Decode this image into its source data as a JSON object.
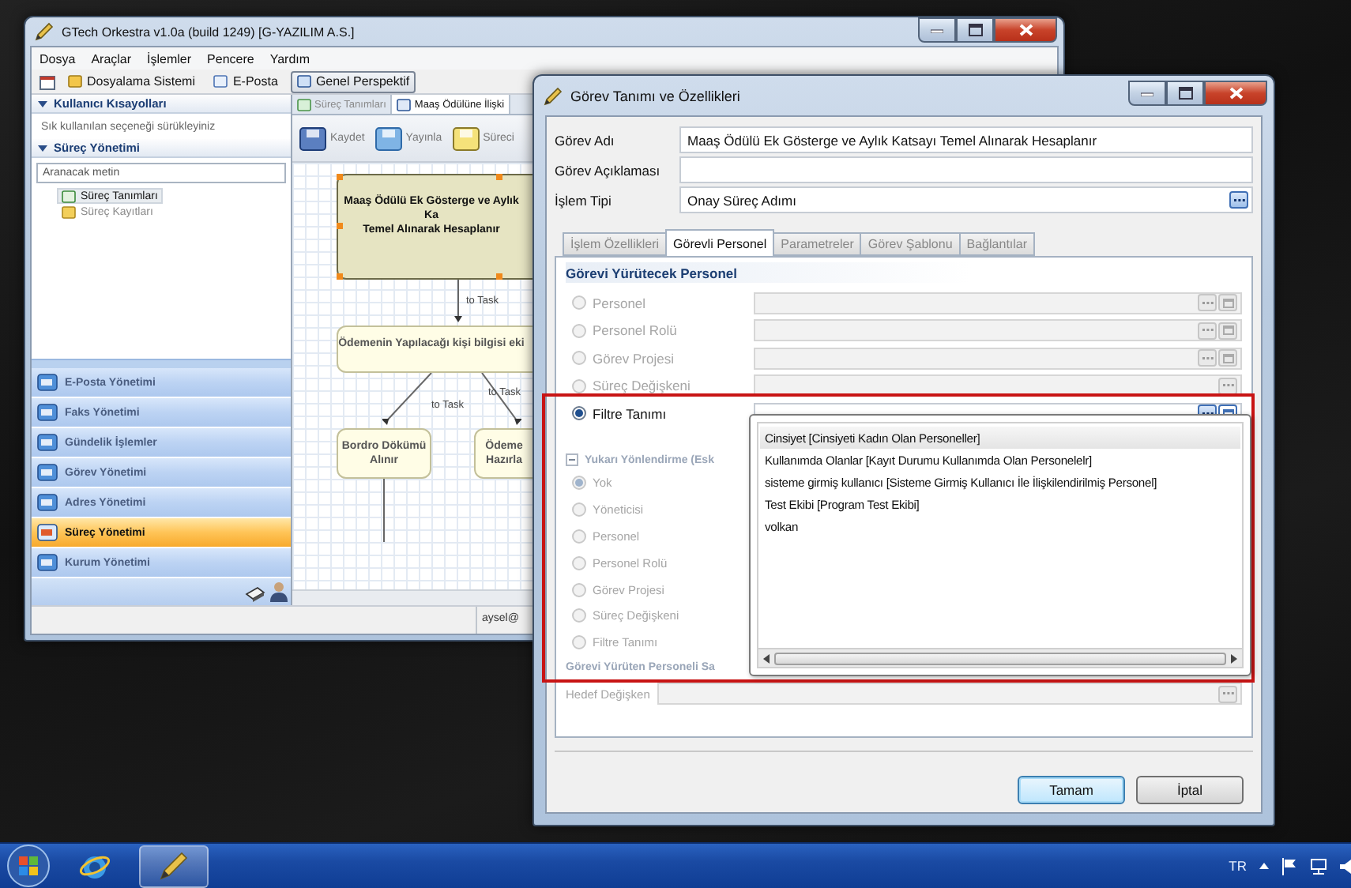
{
  "main_window": {
    "title": "GTech Orkestra v1.0a (build 1249) [G-YAZILIM A.S.]",
    "menu": [
      "Dosya",
      "Araçlar",
      "İşlemler",
      "Pencere",
      "Yardım"
    ],
    "toolbar": [
      {
        "label": "Dosyalama Sistemi",
        "selected": false
      },
      {
        "label": "E-Posta",
        "selected": false
      },
      {
        "label": "Genel Perspektif",
        "selected": true
      }
    ],
    "sidebar": {
      "shortcuts": {
        "title": "Kullanıcı Kısayolları",
        "expanded": true,
        "hint": "Sık kullanılan seçeneği sürükleyiniz"
      },
      "process": {
        "title": "Süreç Yönetimi",
        "expanded": true,
        "search_placeholder": "Aranacak metin",
        "items": [
          {
            "label": "Süreç Tanımları",
            "selected": true
          },
          {
            "label": "Süreç Kayıtları",
            "selected": false
          }
        ]
      },
      "nav": [
        {
          "label": "E-Posta Yönetimi",
          "selected": false
        },
        {
          "label": "Faks Yönetimi",
          "selected": false
        },
        {
          "label": "Gündelik İşlemler",
          "selected": false
        },
        {
          "label": "Görev Yönetimi",
          "selected": false
        },
        {
          "label": "Adres Yönetimi",
          "selected": false
        },
        {
          "label": "Süreç Yönetimi",
          "selected": true
        },
        {
          "label": "Kurum Yönetimi",
          "selected": false
        }
      ]
    },
    "editor": {
      "tabs": [
        {
          "label": "Süreç Tanımları",
          "selected": false
        },
        {
          "label": "Maaş Ödülüne İlişki",
          "selected": true
        }
      ],
      "toolbar": [
        "Kaydet",
        "Yayınla",
        "Süreci"
      ],
      "diagram": {
        "nodes": [
          {
            "lines": [
              "Maaş Ödülü Ek Gösterge ve Aylık Ka",
              "Temel Alınarak Hesaplanır"
            ],
            "selected": true
          },
          {
            "lines": [
              "Ödemenin Yapılacağı kişi bilgisi eki"
            ],
            "selected": false
          },
          {
            "lines": [
              "Bordro Dökümü",
              "Alınır"
            ],
            "selected": false
          },
          {
            "lines": [
              "Ödeme",
              "Hazırla"
            ],
            "selected": false
          }
        ],
        "edges": [
          "to Task",
          "to Task",
          "to Task"
        ]
      }
    },
    "status_bar": {
      "user": "aysel@"
    }
  },
  "dialog": {
    "title": "Görev Tanımı ve Özellikleri",
    "fields": [
      {
        "label": "Görev Adı",
        "value": "Maaş Ödülü Ek Gösterge ve Aylık Katsayı Temel Alınarak Hesaplanır",
        "kind": "text"
      },
      {
        "label": "Görev Açıklaması",
        "kind": "text"
      },
      {
        "label": "İşlem Tipi",
        "value": "Onay Süreç Adımı",
        "kind": "picker"
      }
    ],
    "tabs": [
      {
        "label": "İşlem Özellikleri",
        "selected": false
      },
      {
        "label": "Görevli Personel",
        "selected": true
      },
      {
        "label": "Parametreler",
        "selected": false
      },
      {
        "label": "Görev Şablonu",
        "selected": false
      },
      {
        "label": "Bağlantılar",
        "selected": false
      }
    ],
    "assignee": {
      "title": "Görevi Yürütecek Personel",
      "options": [
        {
          "label": "Personel",
          "selected": false,
          "disabled": true,
          "kind": "picker_clear"
        },
        {
          "label": "Personel Rolü",
          "selected": false,
          "disabled": true,
          "kind": "picker_clear"
        },
        {
          "label": "Görev Projesi",
          "selected": false,
          "disabled": true,
          "kind": "picker_clear"
        },
        {
          "label": "Süreç Değişkeni",
          "selected": false,
          "disabled": true,
          "kind": "picker"
        },
        {
          "label": "Filtre Tanımı",
          "selected": true,
          "disabled": false,
          "kind": "picker_clear"
        }
      ]
    },
    "filter_popup": {
      "items": [
        {
          "label": "Cinsiyet [Cinsiyeti Kadın Olan Personeller]",
          "selected": true
        },
        {
          "label": "Kullanımda Olanlar [Kayıt Durumu Kullanımda Olan Personelelr]",
          "selected": false
        },
        {
          "label": "sisteme girmiş kullanıcı [Sisteme Girmiş Kullanıcı İle İlişkilendirilmiş Personel]",
          "selected": false
        },
        {
          "label": "Test Ekibi [Program Test Ekibi]",
          "selected": false
        },
        {
          "label": "volkan",
          "selected": false
        }
      ]
    },
    "escalation": {
      "title": "Yukarı Yönlendirme (Esk",
      "expanded": true,
      "options": [
        {
          "label": "Yok",
          "selected": true,
          "disabled": true
        },
        {
          "label": "Yöneticisi",
          "selected": false,
          "disabled": true
        },
        {
          "label": "Personel",
          "selected": false,
          "disabled": true
        },
        {
          "label": "Personel Rolü",
          "selected": false,
          "disabled": true
        },
        {
          "label": "Görev Projesi",
          "selected": false,
          "disabled": true
        },
        {
          "label": "Süreç Değişkeni",
          "selected": false,
          "disabled": true
        },
        {
          "label": "Filtre Tanımı",
          "selected": false,
          "disabled": true
        }
      ]
    },
    "result": {
      "title": "Görevi Yürüten Personeli Sa",
      "field_label": "Hedef Değişken",
      "disabled": true
    },
    "buttons": [
      {
        "label": "Tamam",
        "default": true
      },
      {
        "label": "İptal",
        "default": false
      }
    ]
  },
  "taskbar": {
    "apps": [
      {
        "kind": "browser",
        "active": false
      },
      {
        "kind": "orkestra",
        "active": true
      }
    ],
    "language": "TR"
  }
}
